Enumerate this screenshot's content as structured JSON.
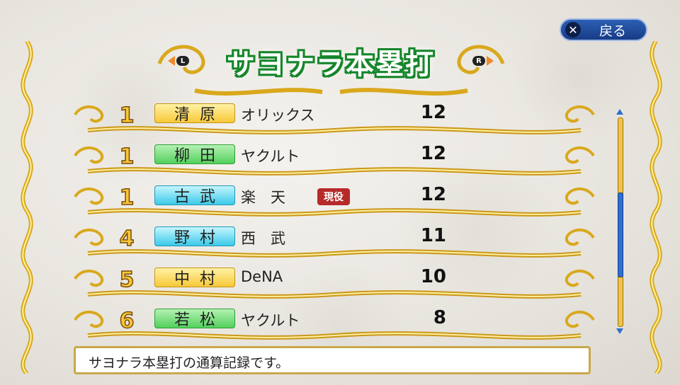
{
  "header": {
    "back_label": "戻る",
    "back_key": "✕",
    "title": "サヨナラ本塁打",
    "prev_key": "L",
    "next_key": "R"
  },
  "rows": [
    {
      "rank": "1",
      "name": "清原",
      "team": "オリックス",
      "count": "12",
      "active": "",
      "badge_color": "gold"
    },
    {
      "rank": "1",
      "name": "柳田",
      "team": "ヤクルト",
      "count": "12",
      "active": "",
      "badge_color": "green"
    },
    {
      "rank": "1",
      "name": "古武",
      "team": "楽　天",
      "count": "12",
      "active": "現役",
      "badge_color": "cyan"
    },
    {
      "rank": "4",
      "name": "野村",
      "team": "西　武",
      "count": "11",
      "active": "",
      "badge_color": "cyan"
    },
    {
      "rank": "5",
      "name": "中村",
      "team": "DeNA",
      "count": "10",
      "active": "",
      "badge_color": "gold"
    },
    {
      "rank": "6",
      "name": "若松",
      "team": "ヤクルト",
      "count": "8",
      "active": "",
      "badge_color": "green"
    }
  ],
  "scroll": {
    "position": 0.6,
    "visible_fraction": 0.4
  },
  "message": "サヨナラ本塁打の通算記録です。",
  "colors": {
    "gold": "#f7c73a",
    "title_green": "#15862a",
    "back_button": "#1f4aa0",
    "active_badge": "#b62a2a"
  }
}
